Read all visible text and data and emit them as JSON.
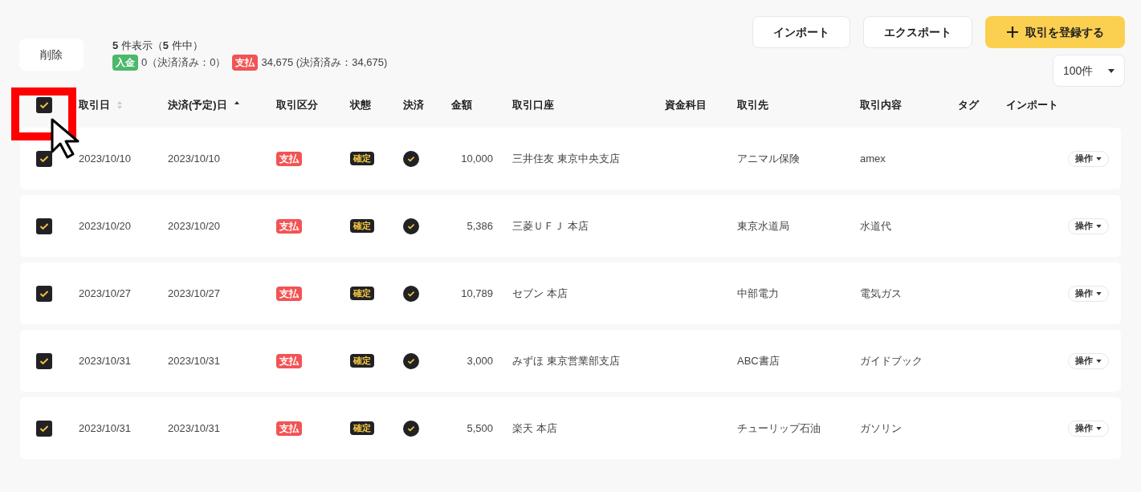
{
  "toolbar": {
    "buttons": [
      {
        "label": "インポート",
        "kind": "plain"
      },
      {
        "label": "エクスポート",
        "kind": "plain"
      },
      {
        "label": "取引を登録する",
        "kind": "primary"
      }
    ]
  },
  "delete_button": "削除",
  "summary": {
    "shown": "5",
    "shown_suffix": "件表示（",
    "total": "5",
    "total_suffix": "件中）",
    "badges": [
      {
        "label": "入金",
        "color": "#4cb86a",
        "text": "0（決済済み：0）"
      },
      {
        "label": "支払",
        "color": "#f25454",
        "text": "34,675 (決済済み：34,675)"
      }
    ]
  },
  "page_size": "100件",
  "header": {
    "select_all_checked": true,
    "columns": [
      {
        "label": "取引日",
        "sortable": true,
        "sorted_ascending": false
      },
      {
        "label": "決済(予定)日",
        "sortable": true,
        "sorted_ascending": true
      },
      {
        "label": "取引区分"
      },
      {
        "label": "状態"
      },
      {
        "label": "決済"
      },
      {
        "label": "金額"
      },
      {
        "label": "取引口座"
      },
      {
        "label": "資金科目"
      },
      {
        "label": "取引先"
      },
      {
        "label": "取引内容"
      },
      {
        "label": "タグ"
      },
      {
        "label": "インポート"
      }
    ]
  },
  "rows": [
    {
      "checked": true,
      "date": "2023/10/10",
      "settle_date": "2023/10/10",
      "category": "支払",
      "is_payment": true,
      "status": "確定",
      "settled": true,
      "amount": "10,000",
      "account": "三井住友 東京中央支店",
      "partner": "アニマル保険",
      "description": "amex",
      "action": "操作"
    },
    {
      "checked": true,
      "date": "2023/10/20",
      "settle_date": "2023/10/20",
      "category": "支払",
      "is_payment": true,
      "status": "確定",
      "settled": true,
      "amount": "5,386",
      "account": "三菱ＵＦＪ 本店",
      "partner": "東京水道局",
      "description": "水道代",
      "action": "操作"
    },
    {
      "checked": true,
      "date": "2023/10/27",
      "settle_date": "2023/10/27",
      "category": "支払",
      "is_payment": true,
      "status": "確定",
      "settled": true,
      "amount": "10,789",
      "account": "セブン 本店",
      "partner": "中部電力",
      "description": "電気ガス",
      "action": "操作"
    },
    {
      "checked": true,
      "date": "2023/10/31",
      "settle_date": "2023/10/31",
      "category": "支払",
      "is_payment": true,
      "status": "確定",
      "settled": true,
      "amount": "3,000",
      "account": "みずほ 東京営業部支店",
      "partner": "ABC書店",
      "description": "ガイドブック",
      "action": "操作"
    },
    {
      "checked": true,
      "date": "2023/10/31",
      "settle_date": "2023/10/31",
      "category": "支払",
      "is_payment": true,
      "status": "確定",
      "settled": true,
      "amount": "5,500",
      "account": "楽天 本店",
      "partner": "チューリップ石油",
      "description": "ガソリン",
      "action": "操作"
    }
  ],
  "annotation": {
    "highlight": true
  }
}
